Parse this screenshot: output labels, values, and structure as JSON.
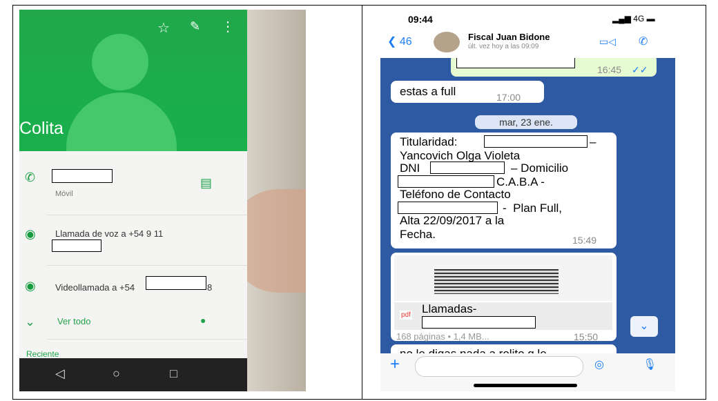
{
  "left_photo": {
    "contact_name": "Colita",
    "icons": {
      "star": "star-icon",
      "edit": "pencil-icon",
      "more": "more-vert-icon"
    },
    "rows": [
      {
        "label": "",
        "sub": "Móvil"
      },
      {
        "label": "Llamada de voz a +54 9 11",
        "sub": ""
      },
      {
        "label": "Videollamada a +54",
        "trailing": "8"
      },
      {
        "label": "Ver todo"
      }
    ],
    "section": "Reciente",
    "nav": [
      "◁",
      "○",
      "□"
    ]
  },
  "chat": {
    "status": {
      "time": "09:44",
      "network": "4G"
    },
    "header": {
      "back_label": "46",
      "contact_name": "Fiscal Juan Bidone",
      "last_seen": "últ. vez hoy a las 09:09"
    },
    "messages": [
      {
        "type": "out",
        "text": "",
        "time": "16:45"
      },
      {
        "type": "in",
        "text": "estas a full",
        "time": "17:00"
      },
      {
        "type": "date",
        "text": "mar, 23 ene."
      },
      {
        "type": "in",
        "lines": [
          "Titularidad:",
          "Yancovich Olga Violeta",
          "DNI",
          "– Domicilio",
          "C.A.B.A -",
          "Teléfono de Contacto",
          "-  Plan Full,",
          "Alta 22/09/2017 a la",
          "Fecha."
        ],
        "time": "15:49"
      },
      {
        "type": "in-doc",
        "title": "Llamadas-",
        "meta": "168 páginas • 1,4 MB...",
        "time": "15:50",
        "badge": "pdf"
      },
      {
        "type": "in",
        "text": "no le digas nada a rolito q le",
        "time": ""
      }
    ]
  }
}
